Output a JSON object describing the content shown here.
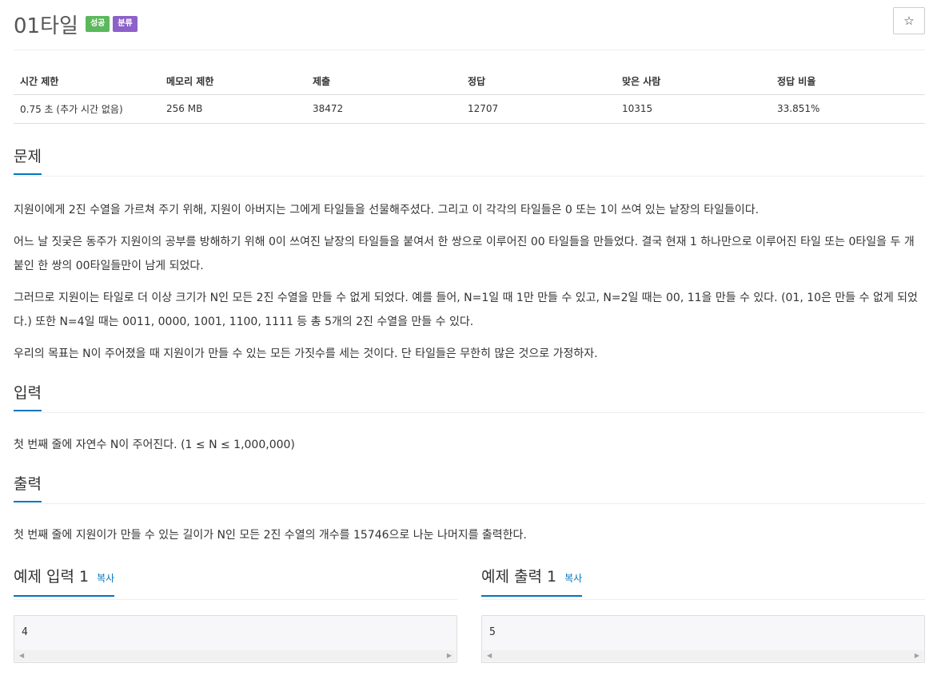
{
  "problem": {
    "title": "01타일",
    "badges": [
      "성공",
      "분류"
    ]
  },
  "star_icon": "☆",
  "info_table": {
    "headers": [
      "시간 제한",
      "메모리 제한",
      "제출",
      "정답",
      "맞은 사람",
      "정답 비율"
    ],
    "row": [
      "0.75 초 (추가 시간 없음)",
      "256 MB",
      "38472",
      "12707",
      "10315",
      "33.851%"
    ]
  },
  "sections": {
    "description": {
      "heading": "문제",
      "paragraphs": [
        "지원이에게 2진 수열을 가르쳐 주기 위해, 지원이 아버지는 그에게 타일들을 선물해주셨다. 그리고 이 각각의 타일들은 0 또는 1이 쓰여 있는 낱장의 타일들이다.",
        "어느 날 짓궂은 동주가 지원이의 공부를 방해하기 위해 0이 쓰여진 낱장의 타일들을 붙여서 한 쌍으로 이루어진 00 타일들을 만들었다. 결국 현재 1 하나만으로 이루어진 타일 또는 0타일을 두 개 붙인 한 쌍의 00타일들만이 남게 되었다.",
        "그러므로 지원이는 타일로 더 이상 크기가 N인 모든 2진 수열을 만들 수 없게 되었다. 예를 들어, N=1일 때 1만 만들 수 있고, N=2일 때는 00, 11을 만들 수 있다. (01, 10은 만들 수 없게 되었다.) 또한 N=4일 때는 0011, 0000, 1001, 1100, 1111 등 총 5개의 2진 수열을 만들 수 있다.",
        "우리의 목표는 N이 주어졌을 때 지원이가 만들 수 있는 모든 가짓수를 세는 것이다. 단 타일들은 무한히 많은 것으로 가정하자."
      ]
    },
    "input": {
      "heading": "입력",
      "text": "첫 번째 줄에 자연수 N이 주어진다. (1 ≤ N ≤ 1,000,000)"
    },
    "output": {
      "heading": "출력",
      "text": "첫 번째 줄에 지원이가 만들 수 있는 길이가 N인 모든 2진 수열의 개수를 15746으로 나눈 나머지를 출력한다."
    }
  },
  "samples": {
    "input": {
      "heading": "예제 입력 1",
      "copy_label": "복사",
      "value": "4"
    },
    "output": {
      "heading": "예제 출력 1",
      "copy_label": "복사",
      "value": "5"
    }
  },
  "scroll_icons": {
    "left": "◀",
    "right": "▶"
  }
}
